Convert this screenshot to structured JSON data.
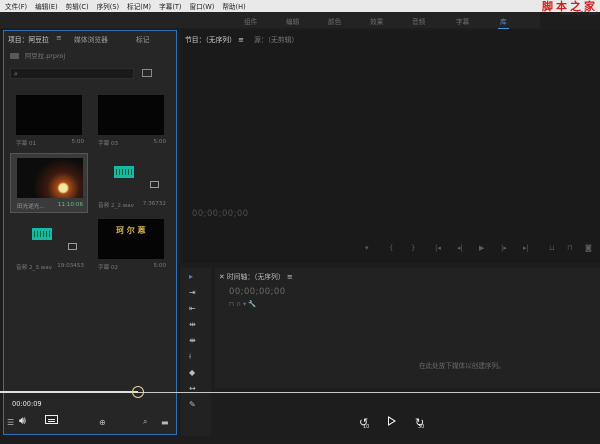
{
  "menubar": {
    "items": [
      "文件(F)",
      "编辑(E)",
      "剪辑(C)",
      "序列(S)",
      "标记(M)",
      "字幕(T)",
      "窗口(W)",
      "帮助(H)"
    ]
  },
  "watermark": {
    "text": "脚本之家",
    "url": "www.jb51.net"
  },
  "workspaces": [
    "组件",
    "编辑",
    "颜色",
    "效果",
    "音频",
    "字幕",
    "库"
  ],
  "project": {
    "tabs": [
      "项目：阿豆拉",
      "媒体浏览器",
      "标记"
    ],
    "file": "阿豆拉.prproj",
    "items": [
      {
        "label": "字幕 01",
        "duration": "5:00"
      },
      {
        "label": "字幕 03",
        "duration": "5:00"
      },
      {
        "label": "田光逆光...",
        "duration": "11:10:06"
      },
      {
        "label": "音频 2_2.wav",
        "duration": "7:36732"
      },
      {
        "label": "音频 2_3.wav",
        "duration": "19:03453"
      },
      {
        "label": "字幕 02",
        "duration": "5:00"
      }
    ]
  },
  "program": {
    "tab_active": "节目：（无序列）",
    "tab_other": "源：（无剪辑）",
    "timecode": "00;00;00;00"
  },
  "timeline": {
    "title": "时间轴：（无序列）",
    "timecode": "00;00;00;00",
    "drop_hint": "在此处放下媒体以创建序列。"
  },
  "player": {
    "current_time": "00:00:09",
    "progress": 0.23,
    "rewind_seconds": "10",
    "forward_seconds": "30"
  }
}
